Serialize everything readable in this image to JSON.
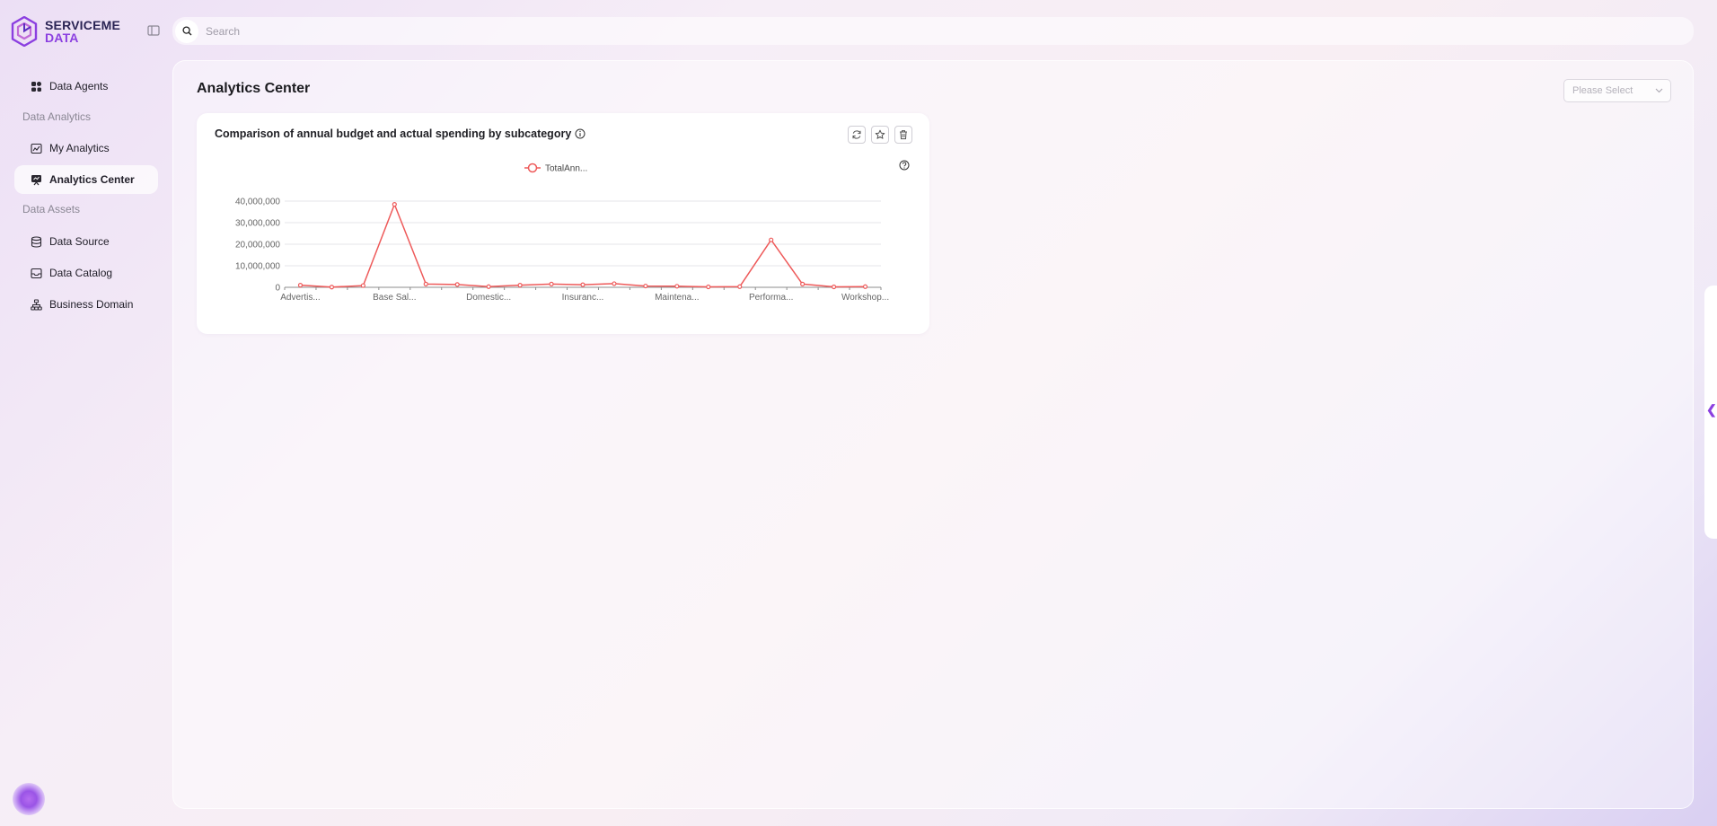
{
  "brand": {
    "line1": "SERVICEME",
    "line2": "DATA"
  },
  "search": {
    "placeholder": "Search"
  },
  "sidebar": {
    "items": [
      {
        "label": "Data Agents"
      },
      {
        "group": "Data Analytics"
      },
      {
        "label": "My Analytics"
      },
      {
        "label": "Analytics Center",
        "active": true
      },
      {
        "group": "Data Assets"
      },
      {
        "label": "Data Source"
      },
      {
        "label": "Data Catalog"
      },
      {
        "label": "Business Domain"
      }
    ]
  },
  "page": {
    "title": "Analytics Center",
    "select_placeholder": "Please Select"
  },
  "card": {
    "title": "Comparison of annual budget and actual spending by subcategory",
    "icons": [
      "refresh-icon",
      "star-icon",
      "trash-icon"
    ]
  },
  "colors": {
    "accent": "#8b3fe0",
    "series": "#ee5a5a"
  },
  "chart_data": {
    "type": "line",
    "series": [
      {
        "name": "TotalAnn...",
        "values": [
          1000000,
          100000,
          800000,
          38500000,
          1500000,
          1300000,
          300000,
          1000000,
          1500000,
          1200000,
          1700000,
          600000,
          500000,
          200000,
          300000,
          22000000,
          1500000,
          200000,
          300000
        ]
      }
    ],
    "x_labels": [
      "Advertis...",
      "Base Sal...",
      "Domestic...",
      "Insuranc...",
      "Maintena...",
      "Performa...",
      "Workshop..."
    ],
    "y_ticks": [
      "0",
      "10,000,000",
      "20,000,000",
      "30,000,000",
      "40,000,000"
    ],
    "ylim": [
      0,
      40000000
    ],
    "grid": true,
    "legend": "top-center"
  }
}
